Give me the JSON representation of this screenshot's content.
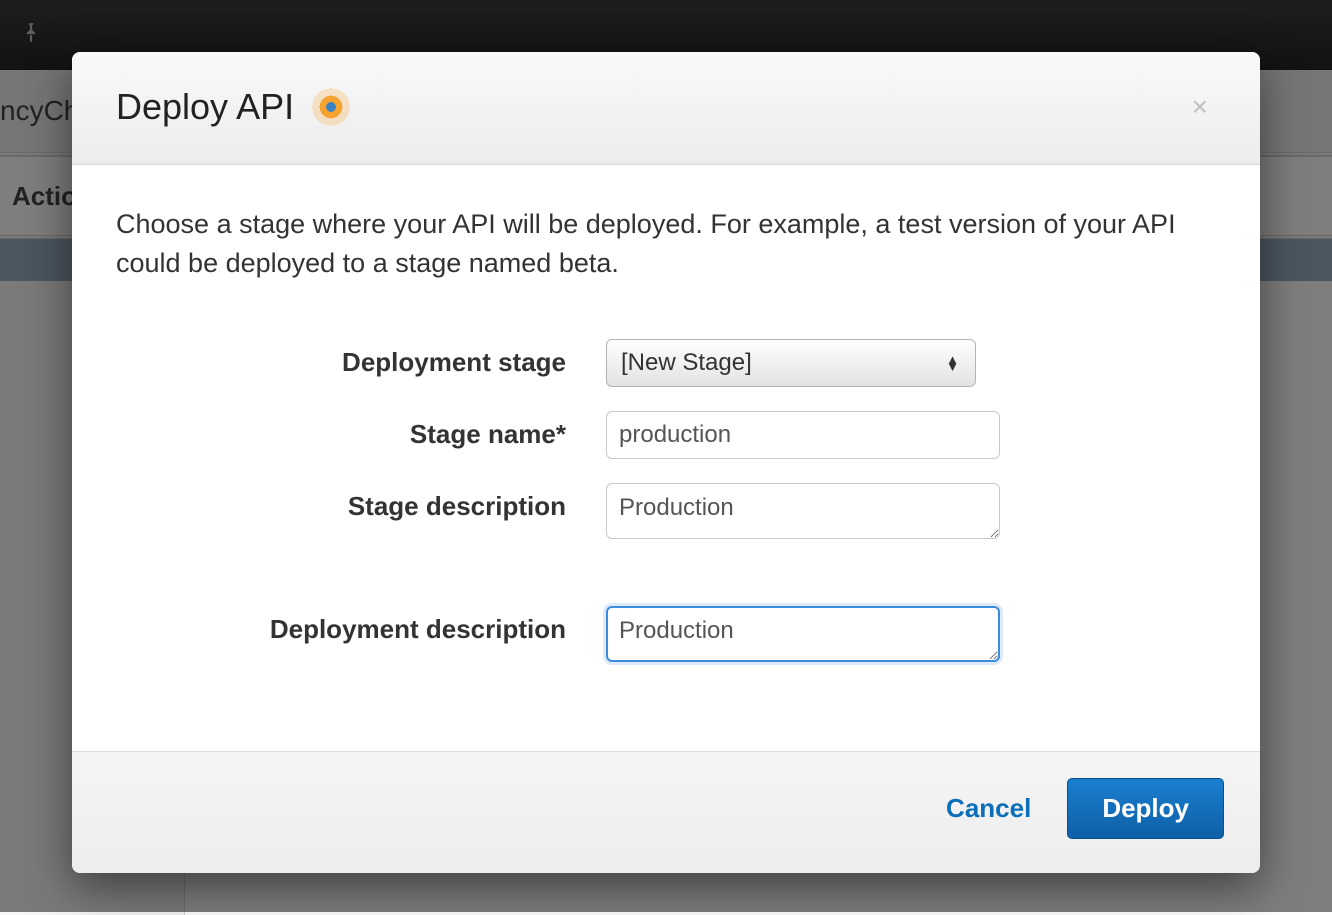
{
  "background": {
    "breadcrumb_fragment": "ncyCh",
    "actions_label": "Actio"
  },
  "modal": {
    "title": "Deploy API",
    "description": "Choose a stage where your API will be deployed. For example, a test version of your API could be deployed to a stage named beta.",
    "close_glyph": "×",
    "form": {
      "deployment_stage": {
        "label": "Deployment stage",
        "selected": "[New Stage]"
      },
      "stage_name": {
        "label": "Stage name*",
        "value": "production"
      },
      "stage_description": {
        "label": "Stage description",
        "value": "Production"
      },
      "deployment_description": {
        "label": "Deployment description",
        "value": "Production"
      }
    },
    "footer": {
      "cancel": "Cancel",
      "deploy": "Deploy"
    }
  }
}
